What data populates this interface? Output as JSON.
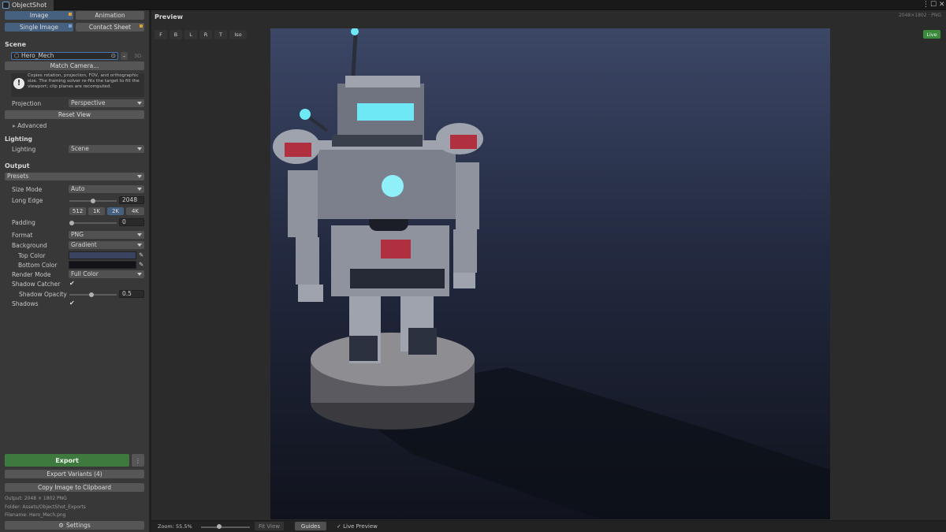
{
  "window": {
    "tab_title": "ObjectShot"
  },
  "mode_tabs": {
    "image": "Image",
    "animation": "Animation",
    "single_image": "Single Image",
    "contact_sheet": "Contact Sheet"
  },
  "scene": {
    "heading": "Scene",
    "target": "Hero_Mech",
    "target_mode": "3D",
    "match_camera": "Match Camera...",
    "info_text": "Copies rotation, projection, FOV, and orthographic size. The framing solver re-fits the target to fill the viewport; clip planes are recomputed.",
    "projection_label": "Projection",
    "projection_value": "Perspective",
    "reset_view": "Reset View",
    "advanced": "Advanced"
  },
  "lighting": {
    "heading": "Lighting",
    "label": "Lighting",
    "value": "Scene"
  },
  "output": {
    "heading": "Output",
    "presets": "Presets",
    "size_mode_label": "Size Mode",
    "size_mode_value": "Auto",
    "long_edge_label": "Long Edge",
    "long_edge_value": "2048",
    "long_edge_fraction": 0.48,
    "sizes": [
      "512",
      "1K",
      "2K",
      "4K"
    ],
    "selected_size": "2K",
    "padding_label": "Padding",
    "padding_value": "0",
    "format_label": "Format",
    "format_value": "PNG",
    "background_label": "Background",
    "background_value": "Gradient",
    "top_color_label": "Top Color",
    "top_color": "#3a4460",
    "bottom_color_label": "Bottom Color",
    "bottom_color": "#111318",
    "render_mode_label": "Render Mode",
    "render_mode_value": "Full Color",
    "shadow_catcher_label": "Shadow Catcher",
    "shadow_opacity_label": "Shadow Opacity",
    "shadow_opacity_value": "0.5",
    "shadows_label": "Shadows",
    "checkmark": "✔"
  },
  "actions": {
    "export": "Export",
    "more": "⋮",
    "export_variants": "Export Variants (4)",
    "copy_clipboard": "Copy Image to Clipboard"
  },
  "footer": {
    "output": "Output: 2048 × 1802 PNG",
    "folder": "Folder: Assets/ObjectShot_Exports",
    "filename": "Filename: Hero_Mech.png",
    "settings": "Settings"
  },
  "preview": {
    "heading": "Preview",
    "dimensions": "2048×1802 · PNG",
    "live": "Live",
    "view_buttons": [
      "F",
      "B",
      "L",
      "R",
      "T",
      "Iso"
    ]
  },
  "status": {
    "zoom": "Zoom: 55.5%",
    "zoom_fraction": 0.55,
    "fit_view": "Fit View",
    "guides": "Guides",
    "live_preview": "Live Preview"
  },
  "colors": {
    "accent": "#46607f",
    "export_green": "#3e7a3e",
    "live_green": "#3b8a3b",
    "eye_glow": "#6fe8f5",
    "panel_red": "#b03040"
  }
}
